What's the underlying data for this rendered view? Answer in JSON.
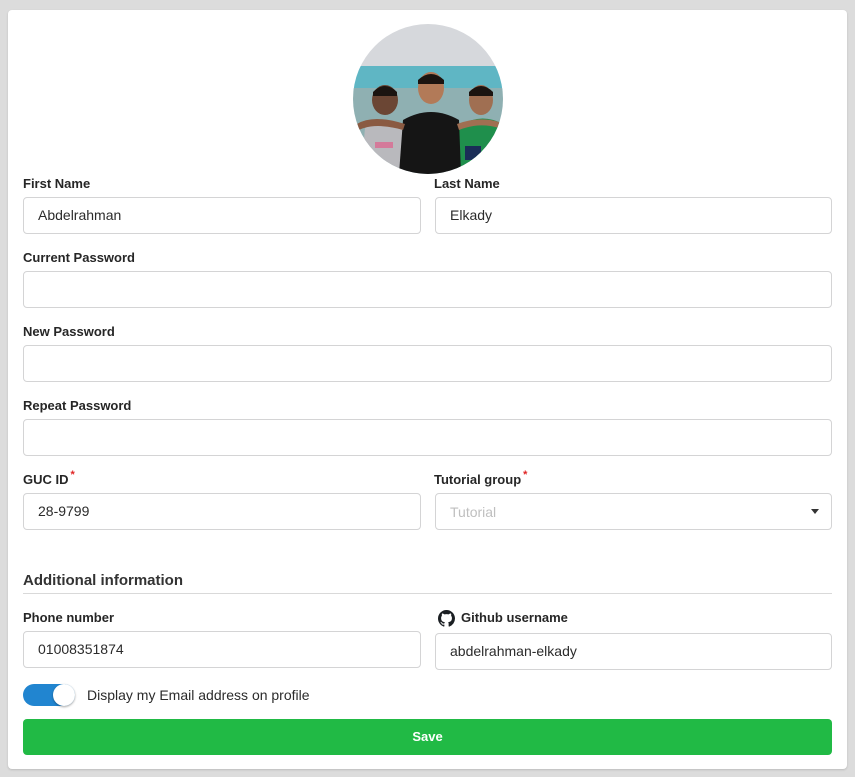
{
  "profile": {
    "avatar": "profile-photo"
  },
  "form": {
    "first_name": {
      "label": "First Name",
      "value": "Abdelrahman"
    },
    "last_name": {
      "label": "Last Name",
      "value": "Elkady"
    },
    "current_password": {
      "label": "Current Password",
      "value": ""
    },
    "new_password": {
      "label": "New Password",
      "value": ""
    },
    "repeat_password": {
      "label": "Repeat Password",
      "value": ""
    },
    "guc_id": {
      "label": "GUC ID",
      "required_mark": "*",
      "value": "28-9799"
    },
    "tutorial_group": {
      "label": "Tutorial group",
      "required_mark": "*",
      "placeholder": "Tutorial"
    }
  },
  "additional": {
    "title": "Additional information",
    "phone": {
      "label": "Phone number",
      "value": "01008351874"
    },
    "github": {
      "label": "Github username",
      "icon": "github-icon",
      "value": "abdelrahman-elkady"
    },
    "display_email": {
      "label": "Display my Email address on profile",
      "checked": true
    }
  },
  "actions": {
    "save_label": "Save"
  },
  "colors": {
    "primary_toggle": "#2185d0",
    "save_button": "#21ba45",
    "required": "#e02424"
  }
}
